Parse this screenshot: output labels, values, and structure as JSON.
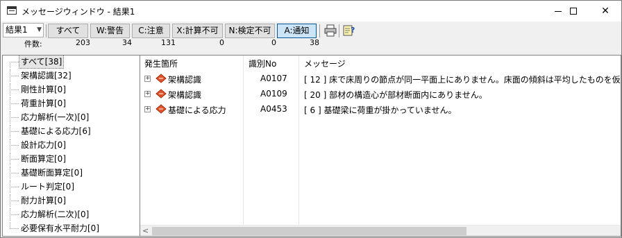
{
  "window": {
    "title": "メッセージウィンドウ - 結果1",
    "minimize_glyph": "",
    "maximize_glyph": "",
    "close_glyph": "✕"
  },
  "toolbar": {
    "result_select": "結果1",
    "buttons": {
      "all": "すべて",
      "warning": "W:警告",
      "caution": "C:注意",
      "calc_impossible": "X:計算不可",
      "check_impossible": "N:検定不可",
      "notice": "A:通知"
    },
    "print_icon": "printer-icon",
    "help_icon": "help-icon"
  },
  "counts": {
    "label": "件数:",
    "all": "203",
    "warning": "34",
    "caution": "131",
    "calc_impossible": "0",
    "check_impossible": "0",
    "notice": "38"
  },
  "tree": {
    "items": [
      "すべて[38]",
      "架構認識[32]",
      "剛性計算[0]",
      "荷重計算[0]",
      "応力解析(一次)[0]",
      "基礎による応力[6]",
      "設計応力[0]",
      "断面算定[0]",
      "基礎断面算定[0]",
      "ルート判定[0]",
      "耐力計算[0]",
      "応力解析(二次)[0]",
      "必要保有水平耐力[0]"
    ]
  },
  "grid": {
    "headers": {
      "source": "発生箇所",
      "code": "識別No",
      "message": "メッセージ"
    },
    "rows": [
      {
        "source": "架構認識",
        "code": "A0107",
        "message": "[ 12 ] 床で床周りの節点が同一平面上にありません。床面の傾斜は平均したものを仮"
      },
      {
        "source": "架構認識",
        "code": "A0109",
        "message": "[ 20 ] 部材の構造心が部材断面内にありません。"
      },
      {
        "source": "基礎による応力",
        "code": "A0453",
        "message": "[ 6 ] 基礎梁に荷重が掛かっていません。"
      }
    ],
    "scroll_left_glyph": "<"
  },
  "colors": {
    "accent": "#cce4f7",
    "book_icon": "#e2562b"
  }
}
